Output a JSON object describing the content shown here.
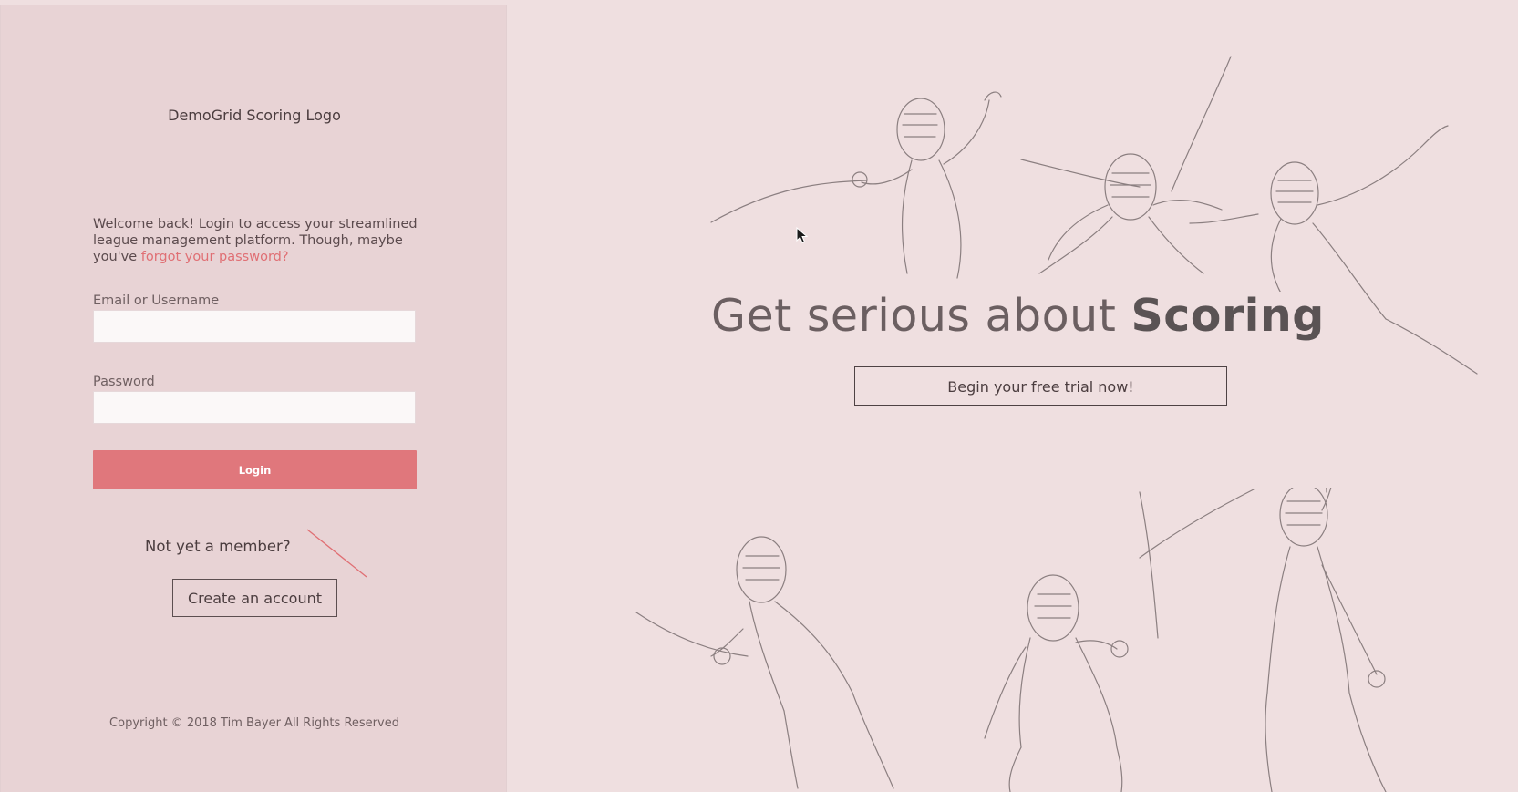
{
  "login_panel": {
    "logo_text": "DemoGrid Scoring Logo",
    "welcome_text": "Welcome back! Login to access your streamlined league management platform. Though, maybe you've ",
    "forgot_link": "forgot your password?",
    "email_label": "Email or Username",
    "email_value": "",
    "password_label": "Password",
    "password_value": "",
    "login_button": "Login",
    "not_member_text": "Not yet a member?",
    "create_account_button": "Create an account",
    "copyright": "Copyright © 2018 Tim Bayer All Rights Reserved"
  },
  "hero": {
    "title_prefix": "Get serious about ",
    "title_emphasis": "Scoring",
    "trial_button": "Begin your free trial now!"
  },
  "colors": {
    "left_panel_bg": "#e8d3d5",
    "page_bg": "#efdfe0",
    "accent": "#e0777c",
    "link": "#e06f74"
  },
  "icons": {
    "cursor": "mouse-pointer-icon",
    "illustration": "fencers-sketch-illustration"
  }
}
